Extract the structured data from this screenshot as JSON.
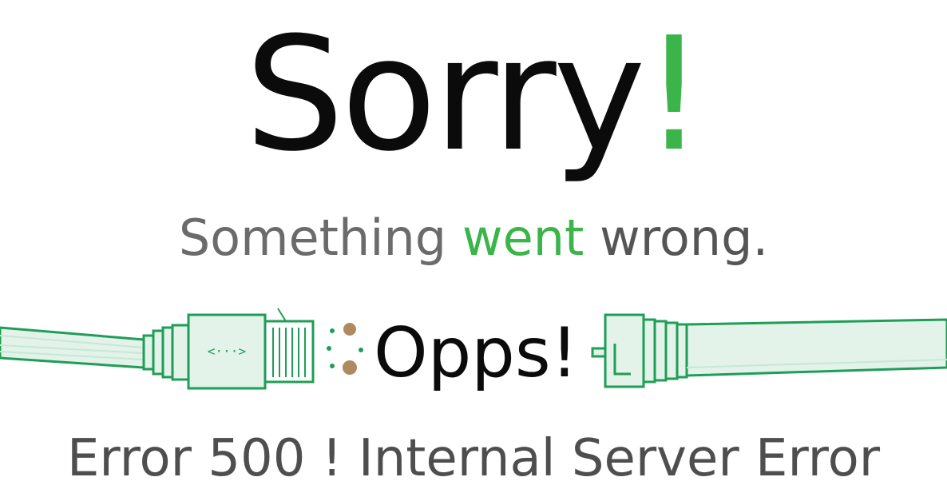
{
  "headline": {
    "text": "Sorry",
    "exclamation": "!"
  },
  "subheading": {
    "part1": "Something ",
    "part2": "went",
    "part3": " wrong."
  },
  "illustration": {
    "connector_glyph": "<···>",
    "center_text": "Opps!"
  },
  "error_message": "Error 500 ! Internal Server Error",
  "colors": {
    "accent": "#3bb54a",
    "text_dark": "#0b0b0b",
    "text_gray": "#6b6b6b",
    "cable_green": "#1f9e57",
    "cable_fill": "#e3f3ea",
    "spark": "#b0895f"
  },
  "icons": [
    "left-cable-icon",
    "left-plug-icon",
    "sparks-icon",
    "right-plug-icon",
    "right-cable-icon"
  ]
}
